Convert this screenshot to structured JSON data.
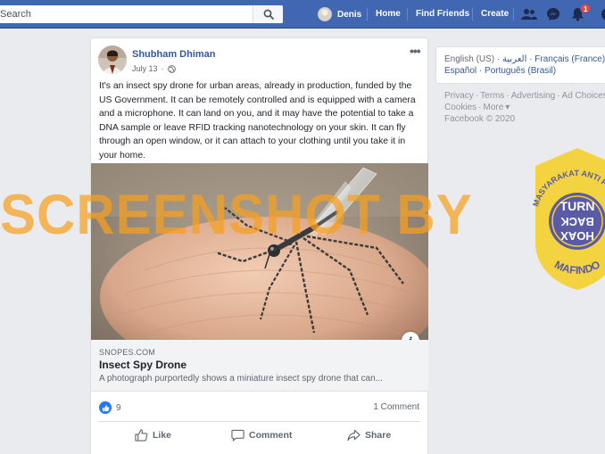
{
  "topbar": {
    "search_placeholder": "Search",
    "profile_name": "Denis",
    "home_label": "Home",
    "find_friends_label": "Find Friends",
    "create_label": "Create",
    "notifications_count": "1",
    "icons": [
      "search-icon",
      "friends-icon",
      "messenger-icon",
      "bell-icon"
    ]
  },
  "post": {
    "author": "Shubham Dhiman",
    "date": "July 13",
    "privacy_icon": "globe-icon",
    "text": "It's an insect spy drone for urban areas, already in production, funded by the US Government. It can be remotely controlled and is equipped with a camera and a microphone. It can land on you, and it may have the potential to take a DNA sample or leave RFID tracking nanotechnology on your skin. It can fly through an open window, or it can attach to your clothing until you take it in your home.",
    "link": {
      "domain": "SNOPES.COM",
      "title": "Insect Spy Drone",
      "description": "A photograph purportedly shows a miniature insect spy drone that can..."
    },
    "likes": "9",
    "comments": "1 Comment",
    "actions": {
      "like": "Like",
      "comment": "Comment",
      "share": "Share"
    }
  },
  "sidebar": {
    "languages_line1": {
      "current": "English (US)",
      "arabic": "العربية",
      "french": "Français (France)"
    },
    "languages_line2": {
      "spanish": "Español",
      "portuguese": "Português (Brasil)"
    },
    "footer_links": [
      "Privacy",
      "Terms",
      "Advertising",
      "Ad Choices"
    ],
    "footer_links2": [
      "Cookies",
      "More"
    ],
    "copyright": "Facebook © 2020"
  },
  "overlay": {
    "watermark": "SCREENSHOT BY",
    "seal_top": "MASYARAKAT ANTI FITNAH",
    "seal_bottom": "MAFINDO",
    "seal_center": [
      "TURN",
      "BACK",
      "HOAX"
    ]
  },
  "colors": {
    "brand": "#4267b2",
    "link": "#365899",
    "watermark": "#f7a01e",
    "seal_yellow": "#f5cf28",
    "seal_purple": "#5b5aa6"
  }
}
